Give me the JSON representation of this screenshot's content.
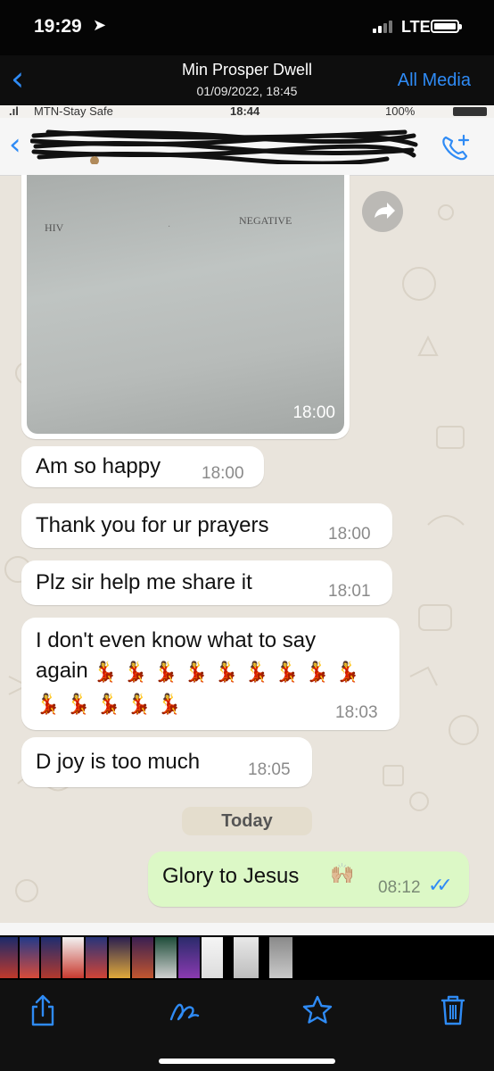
{
  "status_bar": {
    "time": "19:29",
    "network": "LTE"
  },
  "nav": {
    "back_icon": "chevron-left-icon",
    "title": "Min Prosper Dwell",
    "subtitle": "01/09/2022, 18:45",
    "all_media": "All Media"
  },
  "inner_status": {
    "carrier": "MTN-Stay Safe",
    "time": "18:44",
    "battery": "100%"
  },
  "image_message": {
    "label_left": "HIV",
    "label_right": "NEGATIVE",
    "time": "18:00"
  },
  "messages": [
    {
      "text": "Am so happy",
      "time": "18:00"
    },
    {
      "text": "Thank you for ur prayers",
      "time": "18:00"
    },
    {
      "text": "Plz sir help me share it",
      "time": "18:01"
    },
    {
      "text": "I don't even know what to say",
      "text2": "again",
      "time": "18:03"
    },
    {
      "text": "D joy is too much",
      "time": "18:05"
    }
  ],
  "date_separator": "Today",
  "outgoing": {
    "text": "Glory to Jesus",
    "emoji": "🙌🏼",
    "time": "08:12",
    "ticks": "✓✓"
  },
  "toolbar": {
    "share_icon": "share-icon",
    "markup_icon": "markup-pen-icon",
    "favorite_icon": "star-icon",
    "delete_icon": "trash-icon"
  },
  "colors": {
    "ios_blue": "#2f8bf5",
    "chat_bg": "#e9e4dc",
    "outgoing_bubble": "#dcf8c6",
    "incoming_bubble": "#ffffff"
  }
}
